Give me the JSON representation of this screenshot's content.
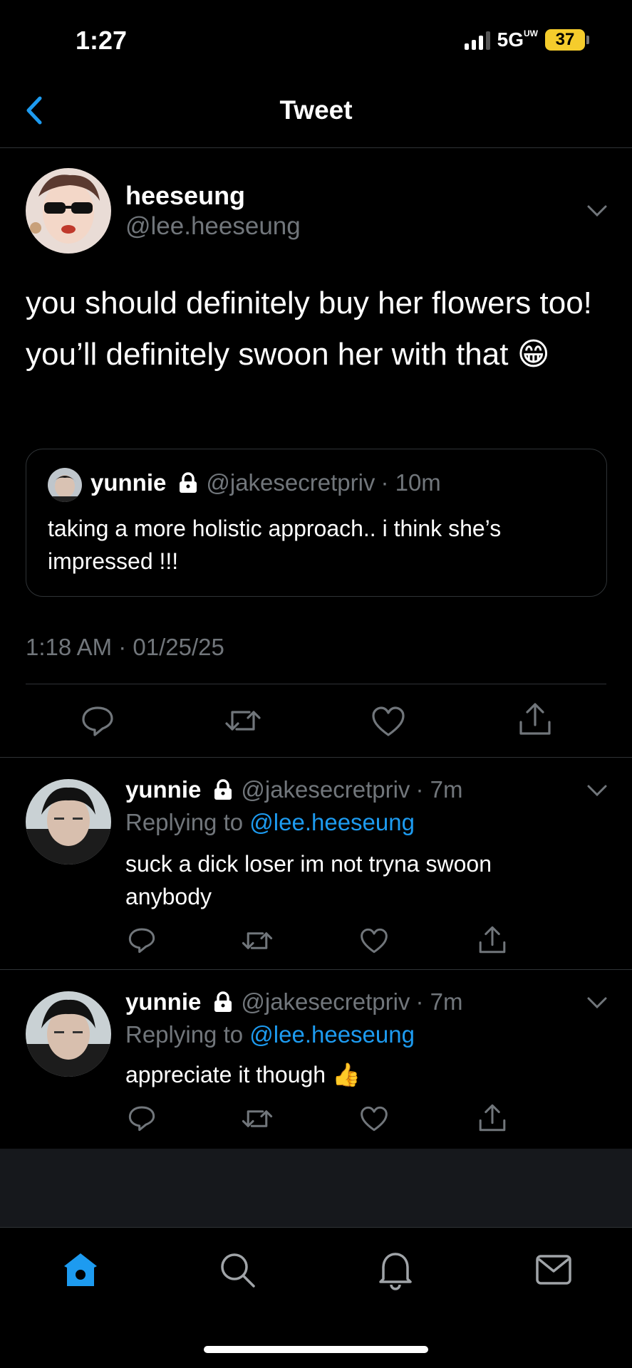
{
  "status_bar": {
    "time": "1:27",
    "network": "5G",
    "network_sup": "UW",
    "battery": "37"
  },
  "header": {
    "title": "Tweet"
  },
  "main_tweet": {
    "display_name": "heeseung",
    "handle": "@lee.heeseung",
    "text": "you should definitely buy her flowers too! you’ll definitely swoon her with that 😁",
    "timestamp": "1:18 AM · 01/25/25",
    "quoted": {
      "display_name": "yunnie",
      "handle": "@jakesecretpriv",
      "time": "· 10m",
      "text": "taking a more holistic approach.. i think she’s impressed !!!"
    }
  },
  "replies": [
    {
      "display_name": "yunnie",
      "handle": "@jakesecretpriv",
      "time": "· 7m",
      "replying_prefix": "Replying to",
      "replying_to": "@lee.heeseung",
      "text": "suck a dick loser im not tryna swoon anybody"
    },
    {
      "display_name": "yunnie",
      "handle": "@jakesecretpriv",
      "time": "· 7m",
      "replying_prefix": "Replying to",
      "replying_to": "@lee.heeseung",
      "text": "appreciate it though 👍"
    }
  ],
  "icons": {
    "back": "chevron-left-icon",
    "more": "chevron-down-icon",
    "lock": "lock-icon",
    "reply": "reply-icon",
    "retweet": "retweet-icon",
    "like": "heart-icon",
    "share": "share-icon",
    "tabs": [
      "home-icon",
      "search-icon",
      "bell-icon",
      "mail-icon"
    ]
  },
  "colors": {
    "accent": "#1d9bf0",
    "background": "#000000",
    "secondary_text": "#71767b",
    "battery": "#f5cc2c"
  }
}
